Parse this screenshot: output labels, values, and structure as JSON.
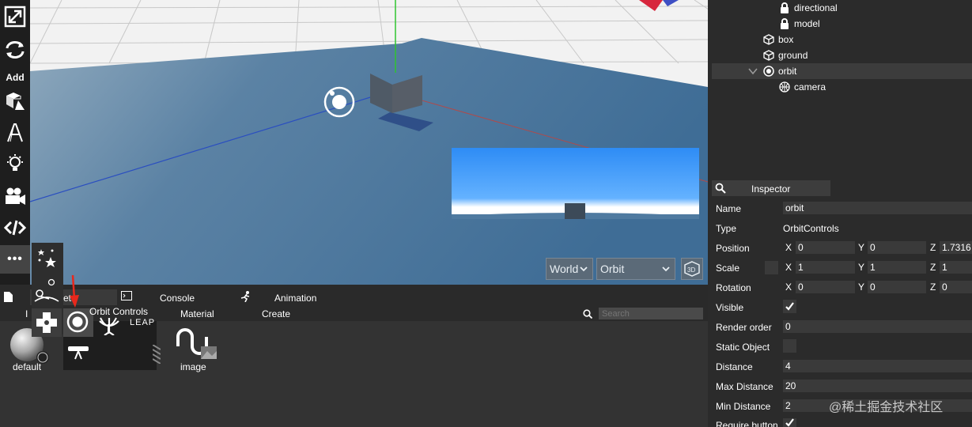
{
  "toolbar": {
    "add_label": "Add",
    "tools": [
      "resize-icon",
      "rotate-icon",
      "add-geometry-icon",
      "text-icon",
      "light-icon",
      "camera-icon",
      "code-icon"
    ],
    "more_label": "•••"
  },
  "viewport": {
    "view_select": "World",
    "mode_select": "Orbit"
  },
  "bottom_tabs": {
    "console": "Console",
    "animation": "Animation",
    "material": "Material",
    "create": "Create",
    "assets_partial": "ets",
    "imports_partial": "I",
    "search_placeholder": "Search"
  },
  "tooltip": "Orbit Controls",
  "assets": {
    "default_label": "default",
    "image_label": "image",
    "leap_text": "LEAP"
  },
  "scene_tree": {
    "items": [
      {
        "label": "directional",
        "icon": "lock-icon"
      },
      {
        "label": "model",
        "icon": "lock-icon"
      },
      {
        "label": "box",
        "icon": "cube-icon"
      },
      {
        "label": "ground",
        "icon": "cube-icon"
      },
      {
        "label": "orbit",
        "icon": "orbit-icon"
      },
      {
        "label": "camera",
        "icon": "camera-globe-icon"
      }
    ]
  },
  "inspector": {
    "title": "Inspector",
    "name_label": "Name",
    "name_value": "orbit",
    "type_label": "Type",
    "type_value": "OrbitControls",
    "position_label": "Position",
    "position": {
      "x": "0",
      "y": "0",
      "z": "1.7316"
    },
    "scale_label": "Scale",
    "scale": {
      "x": "1",
      "y": "1",
      "z": "1"
    },
    "rotation_label": "Rotation",
    "rotation": {
      "x": "0",
      "y": "0",
      "z": "0"
    },
    "visible_label": "Visible",
    "render_order_label": "Render order",
    "render_order": "0",
    "static_label": "Static Object",
    "distance_label": "Distance",
    "distance": "4",
    "max_distance_label": "Max Distance",
    "max_distance": "20",
    "min_distance_label": "Min Distance",
    "min_distance": "2",
    "require_button_label": "Require button",
    "axis_x": "X",
    "axis_y": "Y",
    "axis_z": "Z"
  },
  "watermark": "@稀土掘金技术社区",
  "colors": {
    "accent_arrow": "#e8281c",
    "sky": "#2e8cf5",
    "ground": "#4f7aa0"
  }
}
